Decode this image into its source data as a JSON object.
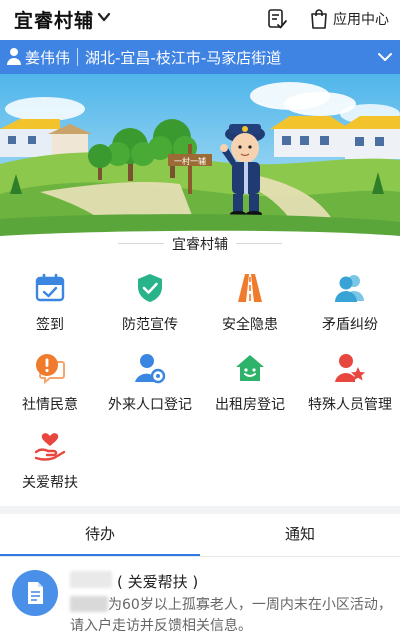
{
  "header": {
    "app_title": "宜睿村辅",
    "app_center_label": "应用中心"
  },
  "location_bar": {
    "user_name": "姜伟伟",
    "location": "湖北-宜昌-枝江市-马家店街道"
  },
  "banner": {
    "signpost_text": "一村一辅"
  },
  "section": {
    "title": "宜睿村辅"
  },
  "grid": [
    {
      "label": "签到",
      "icon": "calendar-check-icon",
      "color": "#3a86e0"
    },
    {
      "label": "防范宣传",
      "icon": "shield-check-icon",
      "color": "#28b38a"
    },
    {
      "label": "安全隐患",
      "icon": "road-icon",
      "color": "#f07b2c"
    },
    {
      "label": "矛盾纠纷",
      "icon": "people-icon",
      "color": "#4fb3d9"
    },
    {
      "label": "社情民意",
      "icon": "speech-alert-icon",
      "color": "#f07b2c"
    },
    {
      "label": "外来人口登记",
      "icon": "person-gear-icon",
      "color": "#3a86e0"
    },
    {
      "label": "出租房登记",
      "icon": "house-smile-icon",
      "color": "#2fb36a"
    },
    {
      "label": "特殊人员管理",
      "icon": "person-star-icon",
      "color": "#e8473f"
    },
    {
      "label": "关爱帮扶",
      "icon": "hand-heart-icon",
      "color": "#e8473f"
    }
  ],
  "tabs": [
    {
      "label": "待办",
      "active": true
    },
    {
      "label": "通知",
      "active": false
    }
  ],
  "task": {
    "category": "( 关爱帮扶 )",
    "description_visible": "为60岁以上孤寡老人，一周内末在小区活动，请入户走访并反馈相关信息。",
    "icon": "document-icon"
  }
}
